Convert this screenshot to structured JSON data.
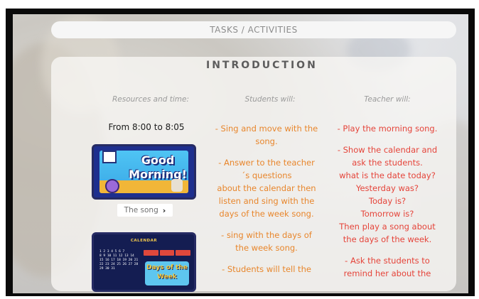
{
  "header": {
    "tasks_label": "TASKS / ACTIVITIES"
  },
  "section": {
    "title": "INTRODUCTION"
  },
  "columns": {
    "resources": "Resources and time:",
    "students": "Students will:",
    "teacher": "Teacher will:"
  },
  "resources": {
    "time": "From 8:00 to 8:05",
    "thumb_good_morning": {
      "line1": "Good",
      "line2": "Morning!"
    },
    "song_button": {
      "label": "The song",
      "chevron": "›"
    },
    "thumb_calendar": {
      "title": "CALENDAR",
      "days_of_week": "Days of the Week",
      "grid_text": "1 2 3 4 5 6 7\n8 9 10 11 12 13 14\n15 16 17 18 19 20 21\n22 23 24 25 26 27 28\n29 30 31"
    }
  },
  "students_text": [
    "- Sing and move with the song.",
    "- Answer to the teacher´s questions\nabout the calendar then listen and sing with the days of the week song.",
    "- sing with the days of the week song.",
    "- Students will tell the"
  ],
  "teacher_text": [
    "- Play the morning song.",
    "- Show the calendar and ask the students.\nwhat is the date today?\nYesterday was?\nToday is?\nTomorrow is?\nThen play a song about the days of the week.",
    "- Ask the students to remind her about the"
  ],
  "colors": {
    "students": "#e8862c",
    "teacher": "#e5443a",
    "thumb_border": "#262b63"
  }
}
